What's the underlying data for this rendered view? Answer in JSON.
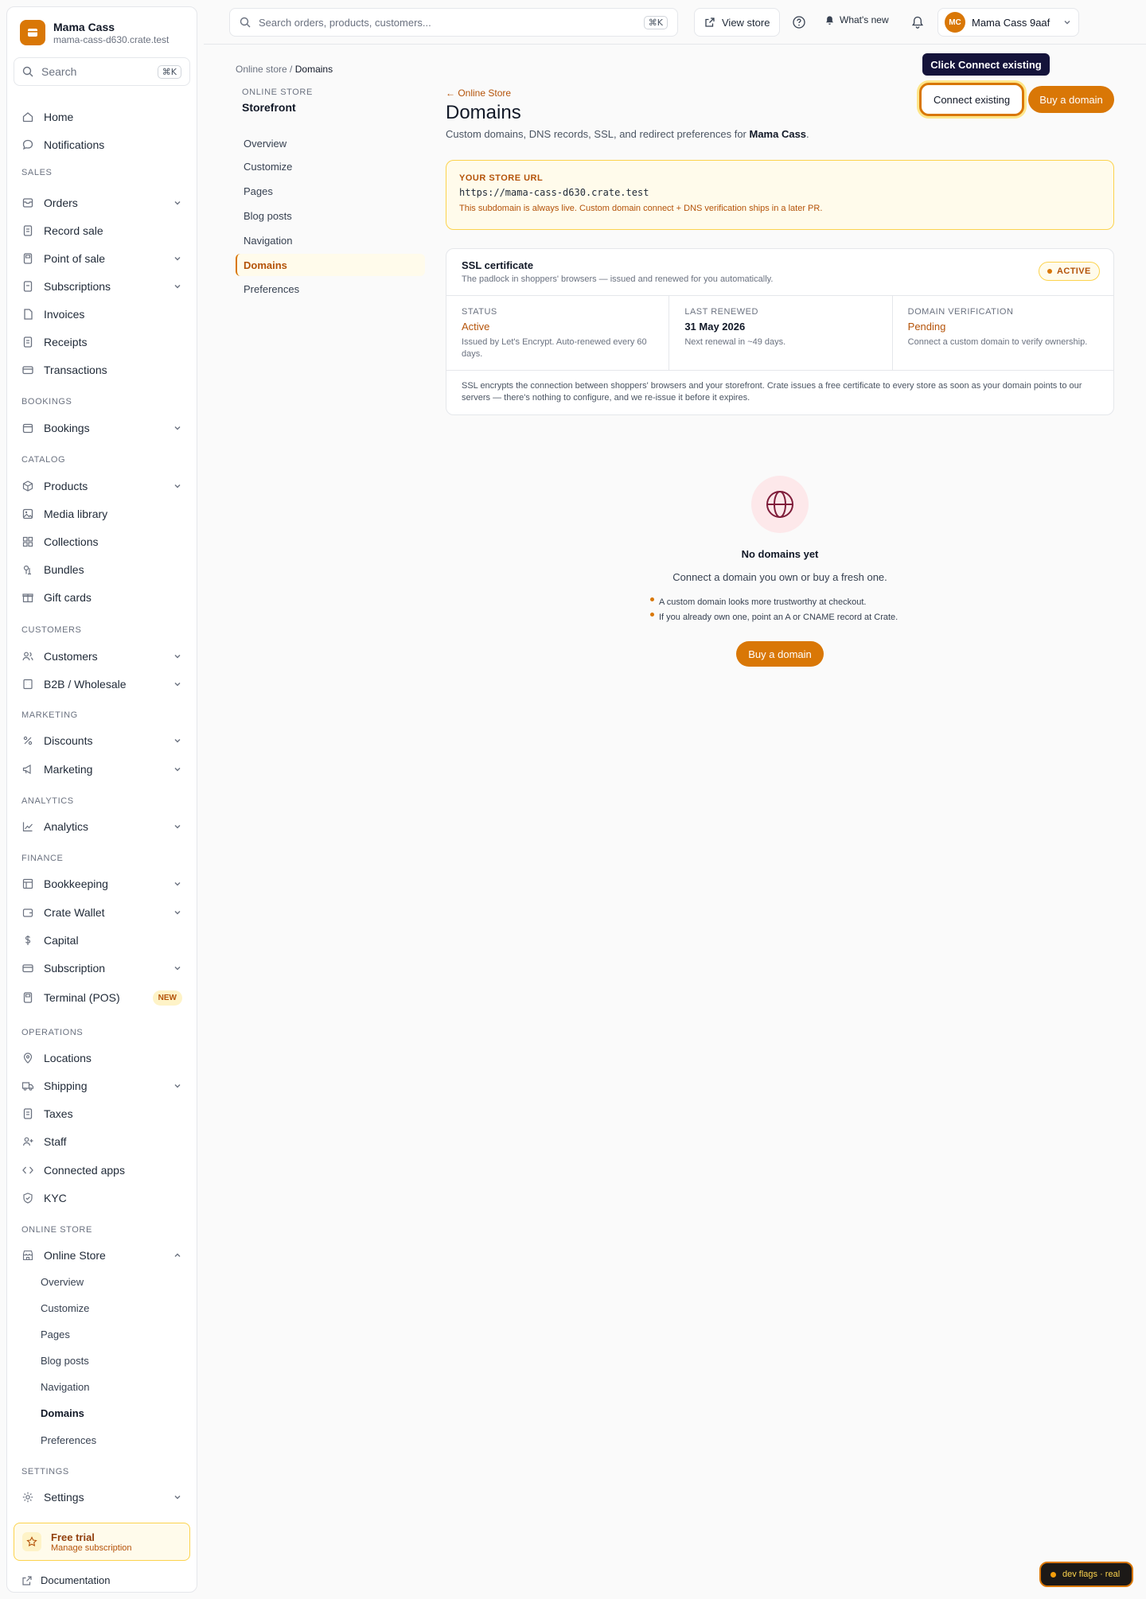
{
  "brand": {
    "name": "Mama Cass",
    "domain": "mama-cass-d630.crate.test"
  },
  "sidebar": {
    "search_placeholder": "Search",
    "search_shortcut": "⌘K",
    "home": "Home",
    "notifications": "Notifications",
    "sections": {
      "sales": "SALES",
      "bookings": "BOOKINGS",
      "catalog": "CATALOG",
      "customers": "CUSTOMERS",
      "marketing": "MARKETING",
      "analytics": "ANALYTICS",
      "finance": "FINANCE",
      "operations": "OPERATIONS",
      "online_store": "ONLINE STORE",
      "settings": "SETTINGS"
    },
    "items": {
      "orders": "Orders",
      "record_sale": "Record sale",
      "point_of_sale": "Point of sale",
      "subscriptions": "Subscriptions",
      "invoices": "Invoices",
      "receipts": "Receipts",
      "transactions": "Transactions",
      "bookings": "Bookings",
      "products": "Products",
      "media_library": "Media library",
      "collections": "Collections",
      "bundles": "Bundles",
      "gift_cards": "Gift cards",
      "customers": "Customers",
      "b2b": "B2B / Wholesale",
      "discounts": "Discounts",
      "marketing": "Marketing",
      "analytics": "Analytics",
      "bookkeeping": "Bookkeeping",
      "crate_wallet": "Crate Wallet",
      "capital": "Capital",
      "subscription": "Subscription",
      "terminal": "Terminal (POS)",
      "terminal_badge": "NEW",
      "locations": "Locations",
      "shipping": "Shipping",
      "taxes": "Taxes",
      "staff": "Staff",
      "connected_apps": "Connected apps",
      "kyc": "KYC",
      "online_store": "Online Store",
      "settings": "Settings"
    },
    "online_store_sub": [
      "Overview",
      "Customize",
      "Pages",
      "Blog posts",
      "Navigation",
      "Domains",
      "Preferences"
    ],
    "trial_title": "Free trial",
    "trial_sub": "Manage subscription",
    "documentation": "Documentation"
  },
  "topbar": {
    "search_placeholder": "Search orders, products, customers...",
    "search_shortcut": "⌘K",
    "view_store": "View store",
    "whats_new": "What's new",
    "avatar_initials": "MC",
    "account_name": "Mama Cass 9aaf"
  },
  "breadcrumb": {
    "parent": "Online store",
    "separator": "/",
    "current": "Domains"
  },
  "subnav": {
    "label": "ONLINE STORE",
    "title": "Storefront",
    "items": [
      "Overview",
      "Customize",
      "Pages",
      "Blog posts",
      "Navigation",
      "Domains",
      "Preferences"
    ]
  },
  "main": {
    "back_link": "← Online Store",
    "title": "Domains",
    "description_prefix": "Custom domains, DNS records, SSL, and redirect preferences for ",
    "description_store": "Mama Cass",
    "description_suffix": ".",
    "tooltip": "Click Connect existing",
    "connect_existing": "Connect existing",
    "buy_domain": "Buy a domain"
  },
  "store_url": {
    "label": "YOUR STORE URL",
    "url": "https://mama-cass-d630.crate.test",
    "note": "This subdomain is always live. Custom domain connect + DNS verification ships in a later PR."
  },
  "ssl": {
    "title": "SSL certificate",
    "subtitle": "The padlock in shoppers' browsers — issued and renewed for you automatically.",
    "badge": "ACTIVE",
    "columns": [
      {
        "label": "STATUS",
        "value": "Active",
        "note": "Issued by Let's Encrypt. Auto-renewed every 60 days."
      },
      {
        "label": "LAST RENEWED",
        "value": "31 May 2026",
        "note": "Next renewal in ~49 days."
      },
      {
        "label": "DOMAIN VERIFICATION",
        "value": "Pending",
        "note": "Connect a custom domain to verify ownership."
      }
    ],
    "footer": "SSL encrypts the connection between shoppers' browsers and your storefront. Crate issues a free certificate to every store as soon as your domain points to our servers — there's nothing to configure, and we re-issue it before it expires."
  },
  "empty_state": {
    "title": "No domains yet",
    "subtitle": "Connect a domain you own or buy a fresh one.",
    "bullets": [
      "A custom domain looks more trustworthy at checkout.",
      "If you already own one, point an A or CNAME record at Crate."
    ],
    "cta": "Buy a domain"
  },
  "dev_flags": "dev flags · real",
  "colors": {
    "accent": "#d97706",
    "accent_dark": "#b45309",
    "tooltip_bg": "#14133a"
  }
}
